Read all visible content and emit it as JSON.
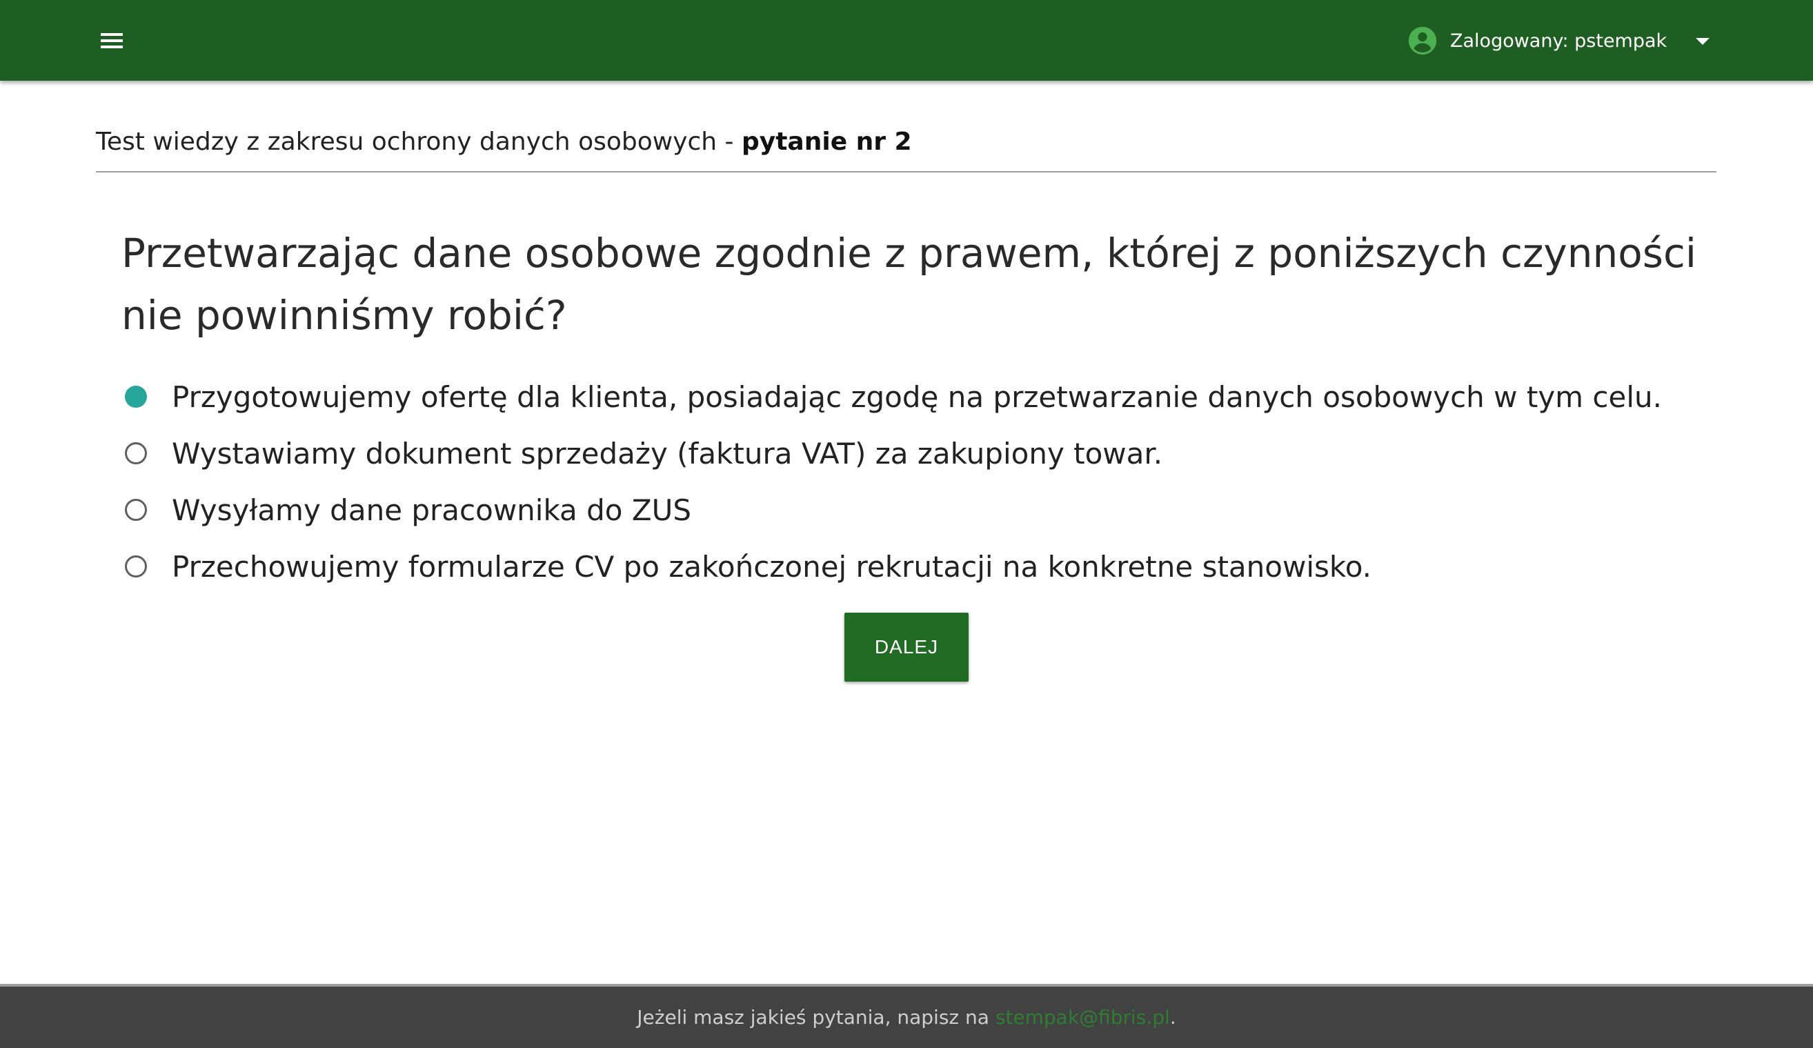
{
  "header": {
    "menu_icon": "hamburger-menu-icon",
    "user_icon": "account-circle-icon",
    "user_label": "Zalogowany: pstempak",
    "dropdown_icon": "caret-down-icon",
    "bar_color": "#1f5e22"
  },
  "quiz": {
    "title_prefix": "Test wiedzy z zakresu ochrony danych osobowych - ",
    "title_question_no": "pytanie nr 2",
    "question": "Przetwarzając dane osobowe zgodnie z prawem, której z poniższych czynności nie powinniśmy robić?",
    "answers": [
      {
        "label": "Przygotowujemy ofertę dla klienta, posiadając zgodę na przetwarzanie danych osobowych w tym celu.",
        "selected": true
      },
      {
        "label": "Wystawiamy dokument sprzedaży (faktura VAT) za zakupiony towar.",
        "selected": false
      },
      {
        "label": "Wysyłamy dane pracownika do ZUS",
        "selected": false
      },
      {
        "label": "Przechowujemy formularze CV po zakończonej rekrutacji na konkretne stanowisko.",
        "selected": false
      }
    ],
    "next_label": "DALEJ",
    "selected_color": "#26a69a"
  },
  "footer": {
    "text_before": "Jeżeli masz jakieś pytania, napisz na ",
    "email": "stempak@fibris.pl",
    "text_after": "."
  }
}
